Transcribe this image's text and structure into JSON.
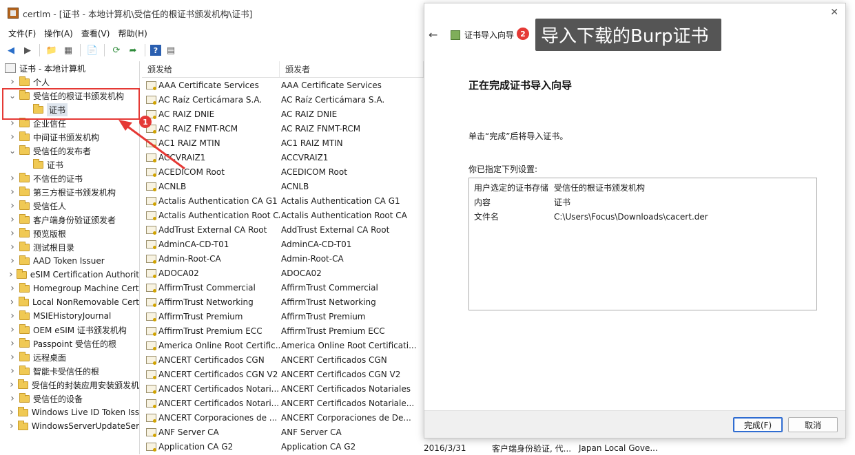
{
  "window": {
    "title": "certlm - [证书 - 本地计算机\\受信任的根证书颁发机构\\证书]"
  },
  "menu": [
    "文件(F)",
    "操作(A)",
    "查看(V)",
    "帮助(H)"
  ],
  "tree": {
    "root": "证书 - 本地计算机",
    "items": [
      {
        "label": "个人",
        "expanded": false,
        "level": 1
      },
      {
        "label": "受信任的根证书颁发机构",
        "expanded": true,
        "level": 1
      },
      {
        "label": "证书",
        "expanded": null,
        "level": 2,
        "selected": true
      },
      {
        "label": "企业信任",
        "expanded": false,
        "level": 1
      },
      {
        "label": "中间证书颁发机构",
        "expanded": false,
        "level": 1
      },
      {
        "label": "受信任的发布者",
        "expanded": true,
        "level": 1
      },
      {
        "label": "证书",
        "expanded": null,
        "level": 2
      },
      {
        "label": "不信任的证书",
        "expanded": false,
        "level": 1
      },
      {
        "label": "第三方根证书颁发机构",
        "expanded": false,
        "level": 1
      },
      {
        "label": "受信任人",
        "expanded": false,
        "level": 1
      },
      {
        "label": "客户端身份验证颁发者",
        "expanded": false,
        "level": 1
      },
      {
        "label": "预览版根",
        "expanded": false,
        "level": 1
      },
      {
        "label": "测试根目录",
        "expanded": false,
        "level": 1
      },
      {
        "label": "AAD Token Issuer",
        "expanded": false,
        "level": 1
      },
      {
        "label": "eSIM Certification Authorit",
        "expanded": false,
        "level": 1
      },
      {
        "label": "Homegroup Machine Cert",
        "expanded": false,
        "level": 1
      },
      {
        "label": "Local NonRemovable Cert",
        "expanded": false,
        "level": 1
      },
      {
        "label": "MSIEHistoryJournal",
        "expanded": false,
        "level": 1
      },
      {
        "label": "OEM eSIM 证书颁发机构",
        "expanded": false,
        "level": 1
      },
      {
        "label": "Passpoint 受信任的根",
        "expanded": false,
        "level": 1
      },
      {
        "label": "远程桌面",
        "expanded": false,
        "level": 1
      },
      {
        "label": "智能卡受信任的根",
        "expanded": false,
        "level": 1
      },
      {
        "label": "受信任的封装应用安装颁发机",
        "expanded": false,
        "level": 1
      },
      {
        "label": "受信任的设备",
        "expanded": false,
        "level": 1
      },
      {
        "label": "Windows Live ID Token Iss",
        "expanded": false,
        "level": 1
      },
      {
        "label": "WindowsServerUpdateSer",
        "expanded": false,
        "level": 1
      }
    ]
  },
  "list": {
    "columns": [
      "颁发给",
      "颁发者"
    ],
    "rows": [
      [
        "AAA Certificate Services",
        "AAA Certificate Services"
      ],
      [
        "AC Raíz Certicámara S.A.",
        "AC Raíz Certicámara S.A."
      ],
      [
        "AC RAIZ DNIE",
        "AC RAIZ DNIE"
      ],
      [
        "AC RAIZ FNMT-RCM",
        "AC RAIZ FNMT-RCM"
      ],
      [
        "AC1 RAIZ MTIN",
        "AC1 RAIZ MTIN"
      ],
      [
        "ACCVRAIZ1",
        "ACCVRAIZ1"
      ],
      [
        "ACEDICOM Root",
        "ACEDICOM Root"
      ],
      [
        "ACNLB",
        "ACNLB"
      ],
      [
        "Actalis Authentication CA G1",
        "Actalis Authentication CA G1"
      ],
      [
        "Actalis Authentication Root CA",
        "Actalis Authentication Root CA"
      ],
      [
        "AddTrust External CA Root",
        "AddTrust External CA Root"
      ],
      [
        "AdminCA-CD-T01",
        "AdminCA-CD-T01"
      ],
      [
        "Admin-Root-CA",
        "Admin-Root-CA"
      ],
      [
        "ADOCA02",
        "ADOCA02"
      ],
      [
        "AffirmTrust Commercial",
        "AffirmTrust Commercial"
      ],
      [
        "AffirmTrust Networking",
        "AffirmTrust Networking"
      ],
      [
        "AffirmTrust Premium",
        "AffirmTrust Premium"
      ],
      [
        "AffirmTrust Premium ECC",
        "AffirmTrust Premium ECC"
      ],
      [
        "America Online Root Certific...",
        "America Online Root Certificati..."
      ],
      [
        "ANCERT Certificados CGN",
        "ANCERT Certificados CGN"
      ],
      [
        "ANCERT Certificados CGN V2",
        "ANCERT Certificados CGN V2"
      ],
      [
        "ANCERT Certificados Notari...",
        "ANCERT Certificados Notariales"
      ],
      [
        "ANCERT Certificados Notari...",
        "ANCERT Certificados Notariale..."
      ],
      [
        "ANCERT Corporaciones de ...",
        "ANCERT Corporaciones de De..."
      ],
      [
        "ANF Server CA",
        "ANF Server CA"
      ],
      [
        "Application CA G2",
        "Application CA G2"
      ]
    ],
    "last_row_extra": [
      "2016/3/31",
      "客户端身份验证, 代...",
      "Japan Local Gove..."
    ]
  },
  "annotations": {
    "marker1": "1",
    "marker2": "2",
    "callout": "导入下载的Burp证书"
  },
  "dialog": {
    "wizard_title": "证书导入向导",
    "heading": "正在完成证书导入向导",
    "instruction": "单击“完成”后将导入证书。",
    "settings_label": "你已指定下列设置:",
    "settings": [
      {
        "key": "用户选定的证书存储",
        "value": "受信任的根证书颁发机构"
      },
      {
        "key": "内容",
        "value": "证书"
      },
      {
        "key": "文件名",
        "value": "C:\\Users\\Focus\\Downloads\\cacert.der"
      }
    ],
    "finish_label": "完成(F)",
    "cancel_label": "取消"
  },
  "colors": {
    "accent": "#2f6cd1",
    "annotation_red": "#e53935",
    "callout_bg": "#555555"
  }
}
